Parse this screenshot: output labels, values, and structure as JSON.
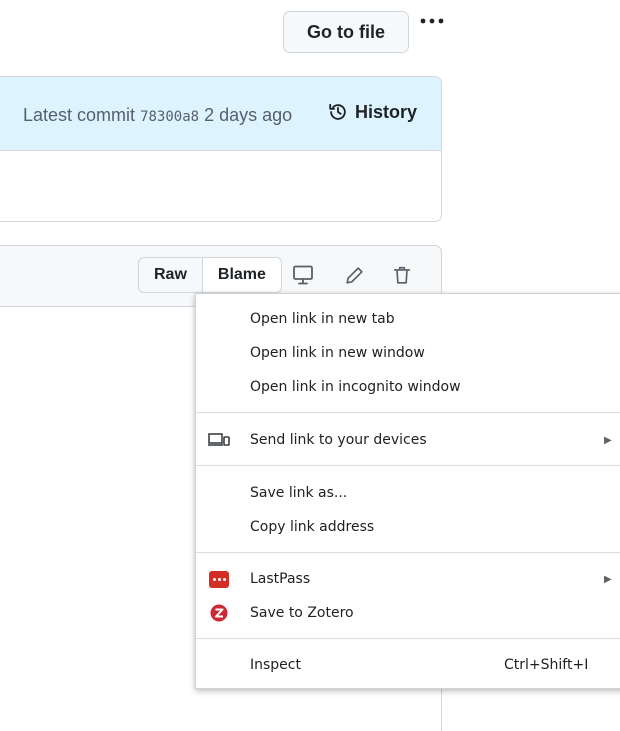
{
  "toolbar": {
    "go_to_file_label": "Go to file",
    "more_options_icon": "kebab-horizontal-icon"
  },
  "commit": {
    "prefix": "Latest commit",
    "sha": "78300a8",
    "age": "2 days ago",
    "history_label": "History",
    "history_icon": "history-icon"
  },
  "file_header": {
    "raw_label": "Raw",
    "blame_label": "Blame",
    "icons": [
      "desktop-icon",
      "pencil-icon",
      "trash-icon"
    ]
  },
  "context_menu": {
    "open_new_tab": "Open link in new tab",
    "open_new_window": "Open link in new window",
    "open_incognito": "Open link in incognito window",
    "send_to_devices": "Send link to your devices",
    "save_link_as": "Save link as...",
    "copy_link_address": "Copy link address",
    "lastpass": "LastPass",
    "save_to_zotero": "Save to Zotero",
    "inspect": "Inspect",
    "inspect_shortcut": "Ctrl+Shift+I",
    "submenu_arrow": "▶"
  },
  "colors": {
    "commit_header_bg": "#ddf4ff",
    "border": "#d0d7de",
    "lastpass_red": "#d32d27",
    "zotero_red": "#cc2936"
  }
}
